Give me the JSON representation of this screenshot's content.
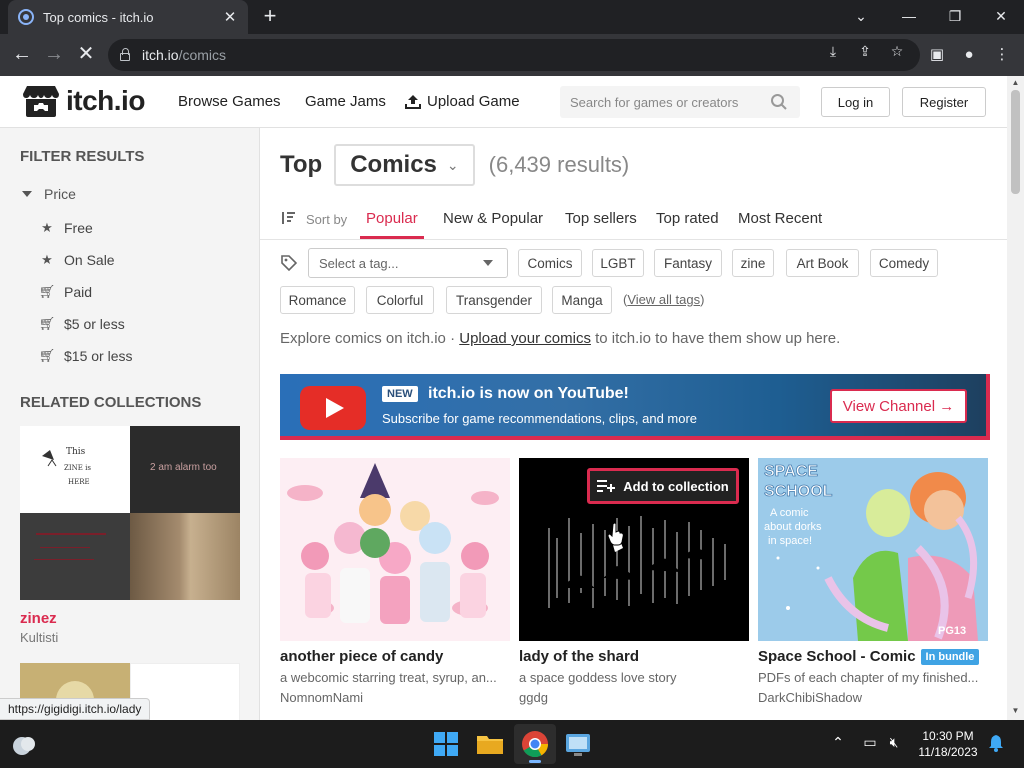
{
  "browser": {
    "tab_title": "Top comics - itch.io",
    "url_host": "itch.io",
    "url_path": "/comics",
    "status_url": "https://gigidigi.itch.io/lady"
  },
  "header": {
    "logo_text": "itch.io",
    "nav": [
      "Browse Games",
      "Game Jams",
      "Upload Game"
    ],
    "search_placeholder": "Search for games or creators",
    "login": "Log in",
    "register": "Register"
  },
  "sidebar": {
    "filter_title": "FILTER RESULTS",
    "price_label": "Price",
    "filters": [
      {
        "label": "Free",
        "icon": "star-icon"
      },
      {
        "label": "On Sale",
        "icon": "star-icon"
      },
      {
        "label": "Paid",
        "icon": "cart-icon"
      },
      {
        "label": "$5 or less",
        "icon": "cart-icon"
      },
      {
        "label": "$15 or less",
        "icon": "cart-icon"
      }
    ],
    "collections_title": "RELATED COLLECTIONS",
    "collection": {
      "name": "zinez",
      "owner": "Kultisti"
    }
  },
  "main": {
    "title_prefix": "Top",
    "category": "Comics",
    "results": "(6,439 results)",
    "sort_by": "Sort by",
    "sort_tabs": [
      "Popular",
      "New & Popular",
      "Top sellers",
      "Top rated",
      "Most Recent"
    ],
    "active_sort": "Popular",
    "tag_placeholder": "Select a tag...",
    "tags": [
      "Comics",
      "LGBT",
      "Fantasy",
      "zine",
      "Art Book",
      "Comedy",
      "Romance",
      "Colorful",
      "Transgender",
      "Manga"
    ],
    "view_all_tags": "View all tags",
    "explore_text": "Explore comics on itch.io · ",
    "explore_link": "Upload your comics",
    "explore_suffix": " to itch.io to have them show up here.",
    "banner": {
      "badge": "NEW",
      "headline": "itch.io is now on YouTube!",
      "sub": "Subscribe for game recommendations, clips, and more",
      "button": "View Channel →"
    },
    "add_to_collection": "Add to collection",
    "games": [
      {
        "title": "another piece of candy",
        "desc": "a webcomic starring treat, syrup, an...",
        "author": "NomnomNami"
      },
      {
        "title": "lady of the shard",
        "desc": "a space goddess love story",
        "author": "ggdg"
      },
      {
        "title": "Space School - Comic",
        "badge": "In bundle",
        "desc": "PDFs of each chapter of my finished...",
        "author": "DarkChibiShadow"
      }
    ],
    "cover_texts": {
      "space_school": [
        "SPACE",
        "SCHOOL"
      ],
      "space_school_sub": "A comic about dorks in space!",
      "collection_thumb_1": "This ZINE is HERE",
      "collection_thumb_2": "2 am alarm too"
    }
  },
  "taskbar": {
    "time": "10:30 PM",
    "date": "11/18/2023"
  },
  "colors": {
    "accent": "#da2b4f",
    "bundle": "#3fa3e4"
  }
}
